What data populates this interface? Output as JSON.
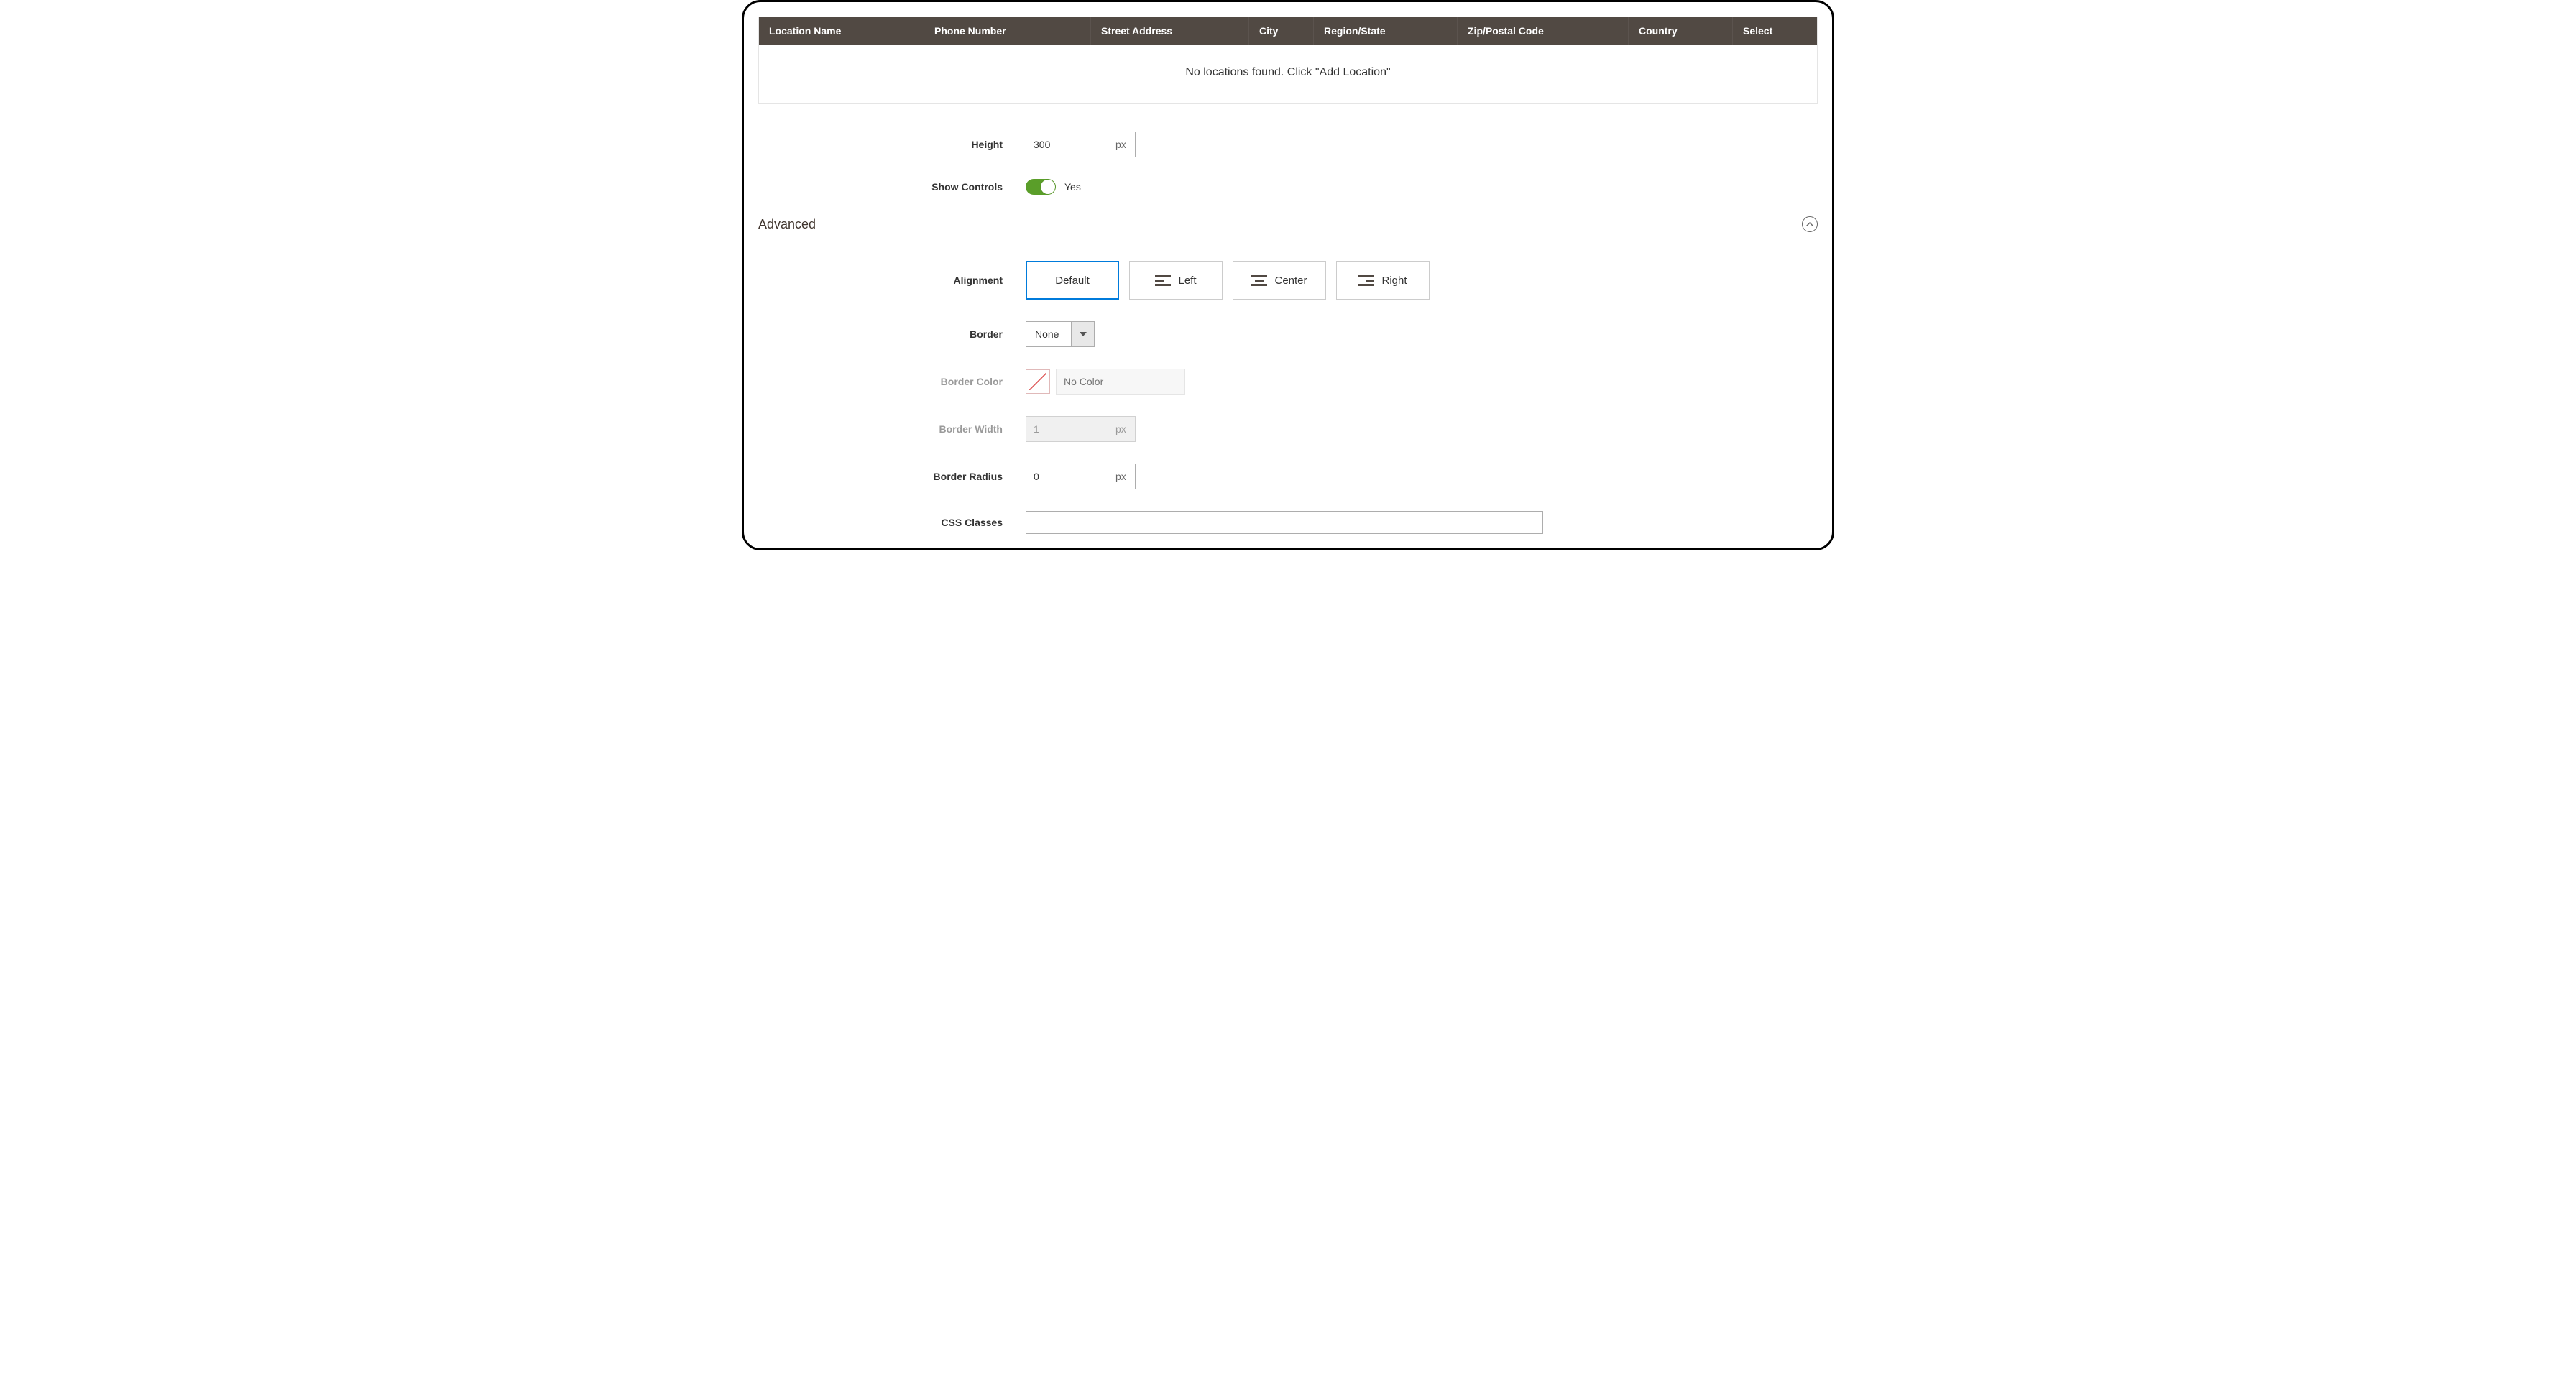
{
  "locations": {
    "headers": {
      "location_name": "Location Name",
      "phone_number": "Phone Number",
      "street_address": "Street Address",
      "city": "City",
      "region_state": "Region/State",
      "zip_postal": "Zip/Postal Code",
      "country": "Country",
      "select": "Select"
    },
    "empty_message": "No locations found. Click \"Add Location\""
  },
  "map_settings": {
    "height": {
      "label": "Height",
      "value": "300",
      "unit": "px"
    },
    "show_controls": {
      "label": "Show Controls",
      "value_text": "Yes"
    }
  },
  "advanced": {
    "title": "Advanced",
    "alignment": {
      "label": "Alignment",
      "options": {
        "default": "Default",
        "left": "Left",
        "center": "Center",
        "right": "Right"
      },
      "selected": "default"
    },
    "border": {
      "label": "Border",
      "value": "None"
    },
    "border_color": {
      "label": "Border Color",
      "placeholder": "No Color"
    },
    "border_width": {
      "label": "Border Width",
      "value": "1",
      "unit": "px"
    },
    "border_radius": {
      "label": "Border Radius",
      "value": "0",
      "unit": "px"
    },
    "css_classes": {
      "label": "CSS Classes",
      "value": ""
    }
  }
}
